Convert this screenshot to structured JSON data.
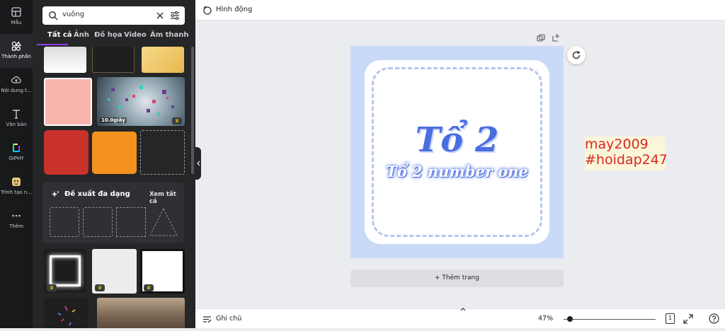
{
  "rail": {
    "items": [
      {
        "label": "Mẫu"
      },
      {
        "label": "Thành phần"
      },
      {
        "label": "Nội dung t..."
      },
      {
        "label": "Văn bản"
      },
      {
        "label": "GIPHY"
      },
      {
        "label": "Trình tạo n..."
      },
      {
        "label": "Thêm"
      }
    ]
  },
  "search": {
    "value": "vuông"
  },
  "tabs": [
    "Tất cả",
    "Ảnh",
    "Đồ họa",
    "Video",
    "Âm thanh"
  ],
  "results": {
    "video_duration": "10.0giây",
    "suggest_title": "Đề xuất đa dạng",
    "suggest_link": "Xem tất cả"
  },
  "topbar": {
    "animate_label": "Hình động"
  },
  "canvas": {
    "title": "Tổ 2",
    "subtitle": "Tổ 2 number one",
    "add_page": "+ Thêm trang"
  },
  "watermark": {
    "line1": "may2009",
    "line2": "#hoidap247"
  },
  "bottombar": {
    "notes_label": "Ghi chú",
    "zoom": "47%",
    "page_number": "1"
  },
  "colors": {
    "rail_bg": "#18191b",
    "panel_bg": "#252627",
    "accent": "#8b3dff",
    "page_bg": "#c9daf8"
  }
}
